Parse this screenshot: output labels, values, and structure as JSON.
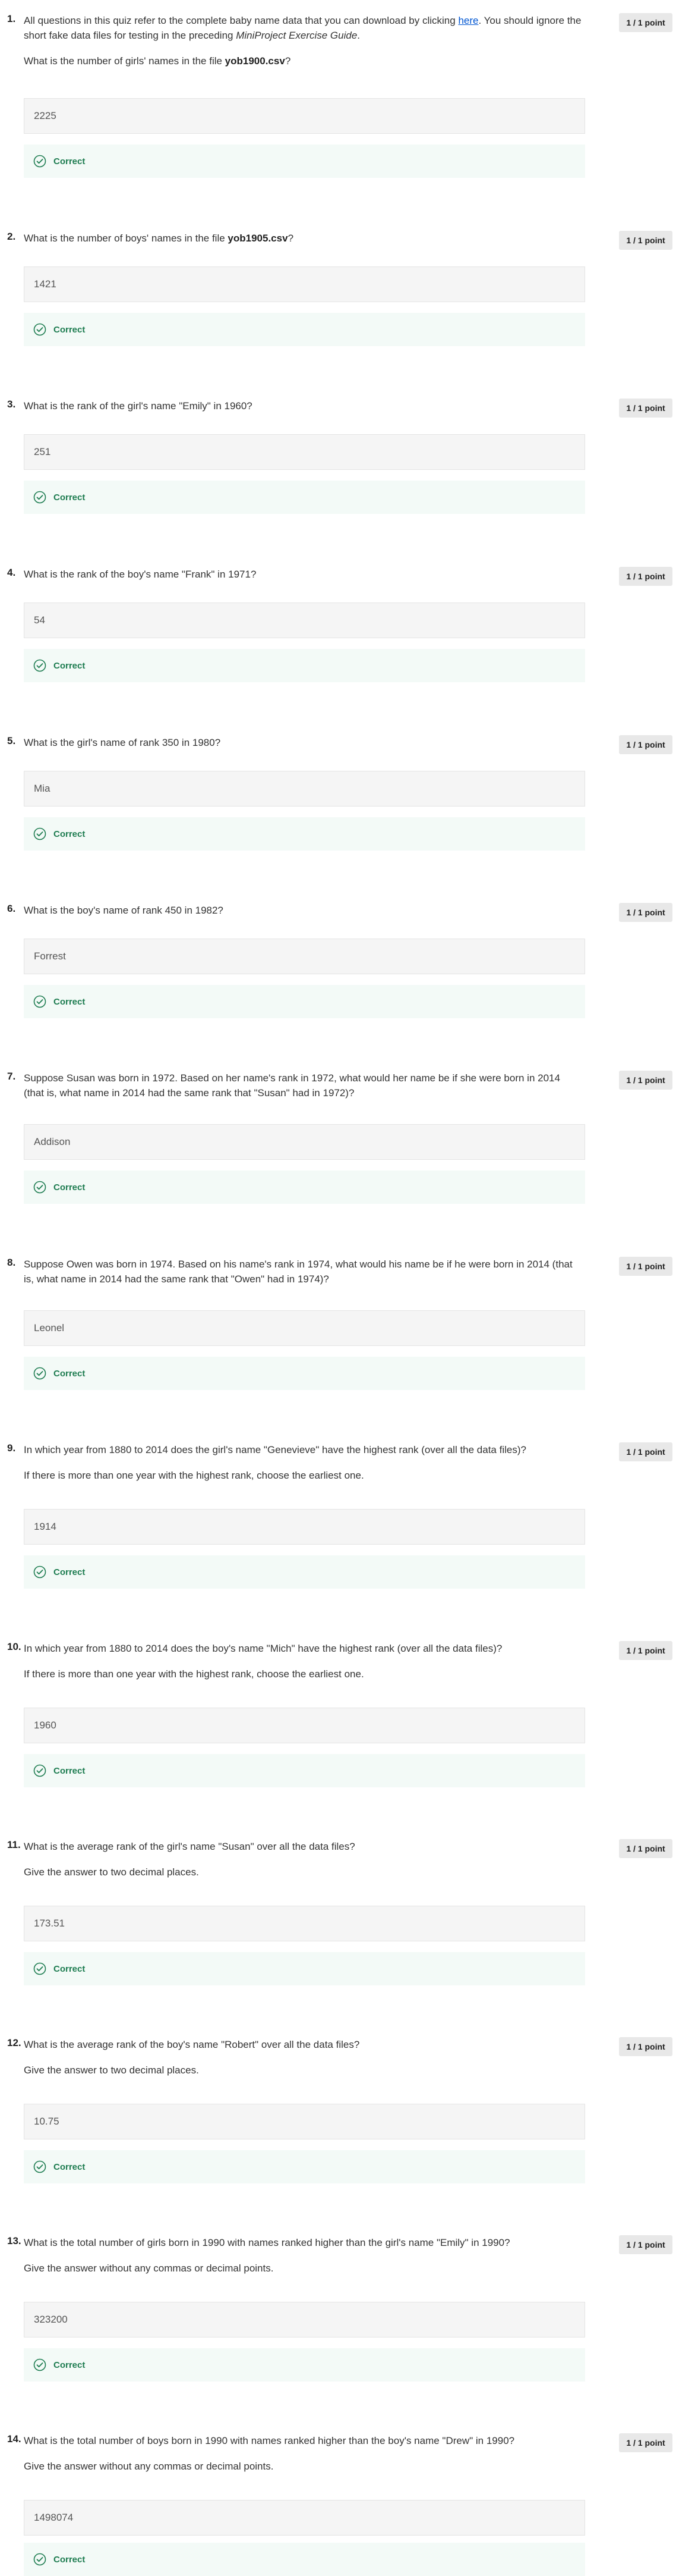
{
  "points_label": "1 / 1 point",
  "feedback_label": "Correct",
  "intro": {
    "part1": "All questions in this quiz refer to the complete baby name data that you can download by clicking ",
    "link": "here",
    "part2": ". You should ignore the short fake data files for testing in the preceding ",
    "guide": "MiniProject Exercise Guide",
    "part3": "."
  },
  "questions": [
    {
      "number": "1.",
      "pre": "What is the number of girls' names in the file ",
      "bold": "yob1900.csv",
      "post": "?",
      "answer": "2225"
    },
    {
      "number": "2.",
      "pre": "What is the number of boys' names in the file ",
      "bold": "yob1905.csv",
      "post": "?",
      "answer": "1421"
    },
    {
      "number": "3.",
      "text": "What is the rank of the girl's name \"Emily\" in 1960?",
      "answer": "251"
    },
    {
      "number": "4.",
      "text": "What is the rank of the boy's name \"Frank\" in 1971?",
      "answer": "54"
    },
    {
      "number": "5.",
      "text": "What is the girl's name of rank 350 in 1980?",
      "answer": "Mia"
    },
    {
      "number": "6.",
      "text": "What is the boy's name of rank 450 in 1982?",
      "answer": "Forrest"
    },
    {
      "number": "7.",
      "text": "Suppose Susan was born in 1972. Based on her name's rank in 1972, what would her name be if she were born in 2014 (that is, what name in 2014 had the same rank that \"Susan\" had in 1972)?",
      "answer": "Addison"
    },
    {
      "number": "8.",
      "text": "Suppose Owen was born in 1974. Based on his name's rank in 1974, what would his name be if he were born in 2014 (that is, what name in 2014 had the same rank that \"Owen\" had in 1974)?",
      "answer": "Leonel"
    },
    {
      "number": "9.",
      "text": "In which year from 1880 to 2014 does the girl's name \"Genevieve\" have the highest rank (over all the data files)?",
      "sub": "If there is more than one year with the highest rank, choose the earliest one.",
      "answer": "1914"
    },
    {
      "number": "10.",
      "text": "In which year from 1880 to 2014 does the boy's name \"Mich\" have the highest rank  (over all the data files)?",
      "sub": "If there is more than one year with the highest rank, choose the earliest one.",
      "answer": "1960"
    },
    {
      "number": "11.",
      "text": "What is the average rank of the girl's name \"Susan\" over all the data files?",
      "sub": "Give the answer to two decimal places.",
      "answer": "173.51"
    },
    {
      "number": "12.",
      "text": "What is the average rank of the boy's name \"Robert\" over all the data files?",
      "sub": "Give the answer to two decimal places.",
      "answer": "10.75"
    },
    {
      "number": "13.",
      "text": "What is the total number of girls born in 1990 with names ranked higher than the girl's name \"Emily\" in 1990?",
      "sub": "Give the answer without any commas or decimal points.",
      "answer": "323200"
    },
    {
      "number": "14.",
      "text": "What is the total number of boys born in 1990 with names ranked higher than the boy's name \"Drew\" in 1990?",
      "sub": "Give the answer without any commas or decimal points.",
      "answer": "1498074"
    }
  ]
}
